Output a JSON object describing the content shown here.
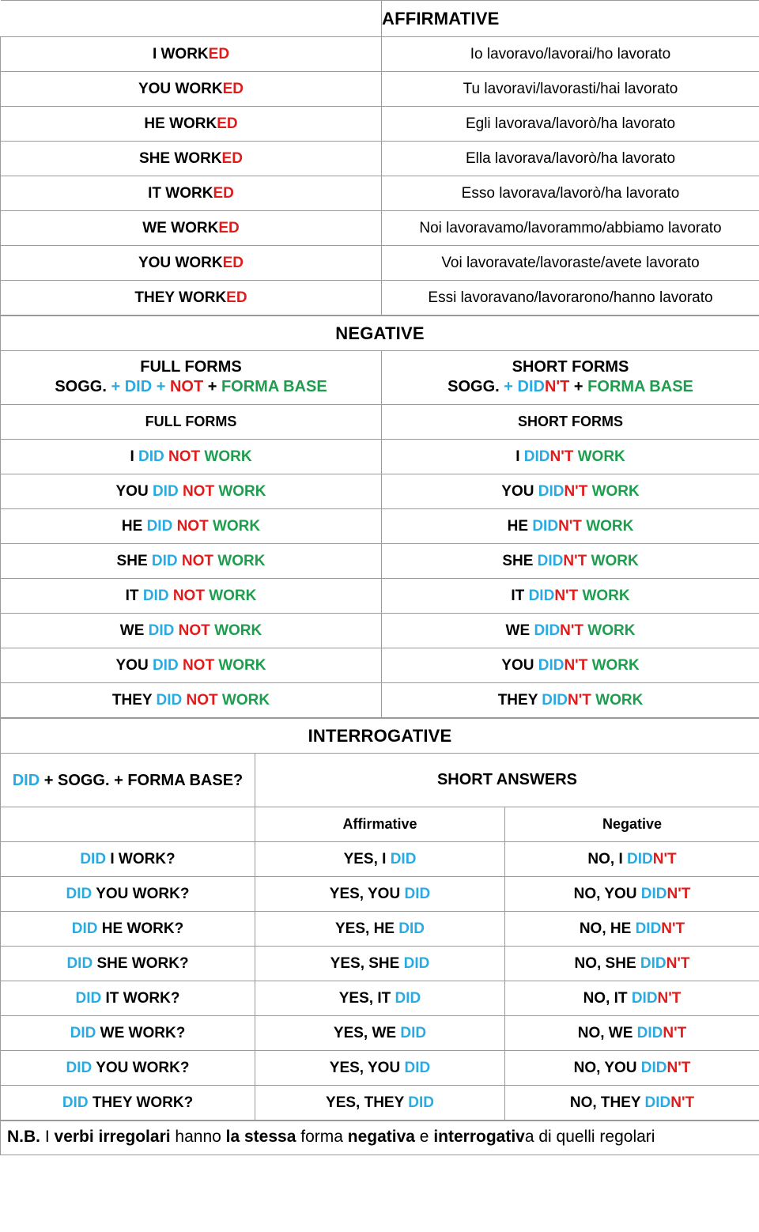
{
  "sections": {
    "affirmative": {
      "title": "AFFIRMATIVE",
      "rows": [
        {
          "subject": "I ",
          "verb": "WORK",
          "suffix": "ED",
          "italian": "Io lavoravo/lavorai/ho lavorato"
        },
        {
          "subject": "YOU ",
          "verb": "WORK",
          "suffix": "ED",
          "italian": "Tu lavoravi/lavorasti/hai lavorato"
        },
        {
          "subject": "HE ",
          "verb": "WORK",
          "suffix": "ED",
          "italian": "Egli lavorava/lavorò/ha lavorato"
        },
        {
          "subject": "SHE ",
          "verb": "WORK",
          "suffix": "ED",
          "italian": "Ella lavorava/lavorò/ha lavorato"
        },
        {
          "subject": "IT ",
          "verb": "WORK",
          "suffix": "ED",
          "italian": "Esso lavorava/lavorò/ha lavorato"
        },
        {
          "subject": "WE ",
          "verb": "WORK",
          "suffix": "ED",
          "italian": "Noi lavoravamo/lavorammo/abbiamo lavorato"
        },
        {
          "subject": "YOU ",
          "verb": "WORK",
          "suffix": "ED",
          "italian": "Voi lavoravate/lavoraste/avete lavorato"
        },
        {
          "subject": "THEY ",
          "verb": "WORK",
          "suffix": "ED",
          "italian": "Essi lavoravano/lavorarono/hanno lavorato"
        }
      ]
    },
    "negative": {
      "title": "NEGATIVE",
      "full_forms_label": "FULL FORMS",
      "short_forms_label": "SHORT FORMS",
      "full_forms_label2": "FULL FORMS",
      "short_forms_label2": "SHORT FORMS",
      "formula_full": {
        "sogg": "SOGG.",
        "plus_did": " + DID",
        "plus2": " + ",
        "not": "NOT",
        "plus3": " + ",
        "base": "FORMA BASE"
      },
      "formula_short": {
        "sogg": "SOGG.",
        "plus": " + ",
        "did": "DID",
        "nt": "N'T",
        "plus3": " + ",
        "base": "FORMA BASE"
      },
      "rows": [
        {
          "subject": "I ",
          "did": "DID ",
          "not": "NOT ",
          "verb": "WORK",
          "s_subject": "I ",
          "s_did": "DID",
          "s_nt": "N'T ",
          "s_verb": "WORK"
        },
        {
          "subject": "YOU ",
          "did": "DID ",
          "not": "NOT ",
          "verb": "WORK",
          "s_subject": "YOU ",
          "s_did": "DID",
          "s_nt": "N'T ",
          "s_verb": "WORK"
        },
        {
          "subject": "HE ",
          "did": "DID ",
          "not": "NOT ",
          "verb": "WORK",
          "s_subject": "HE ",
          "s_did": "DID",
          "s_nt": "N'T ",
          "s_verb": "WORK"
        },
        {
          "subject": "SHE ",
          "did": "DID ",
          "not": "NOT ",
          "verb": "WORK",
          "s_subject": "SHE ",
          "s_did": "DID",
          "s_nt": "N'T ",
          "s_verb": "WORK"
        },
        {
          "subject": "IT ",
          "did": "DID ",
          "not": "NOT ",
          "verb": "WORK",
          "s_subject": "IT ",
          "s_did": "DID",
          "s_nt": "N'T ",
          "s_verb": "WORK"
        },
        {
          "subject": "WE ",
          "did": "DID ",
          "not": "NOT ",
          "verb": "WORK",
          "s_subject": "WE ",
          "s_did": "DID",
          "s_nt": "N'T ",
          "s_verb": "WORK"
        },
        {
          "subject": "YOU ",
          "did": "DID ",
          "not": "NOT ",
          "verb": "WORK",
          "s_subject": "YOU ",
          "s_did": "DID",
          "s_nt": "N'T ",
          "s_verb": "WORK"
        },
        {
          "subject": "THEY ",
          "did": "DID ",
          "not": "NOT ",
          "verb": "WORK",
          "s_subject": "THEY ",
          "s_did": "DID",
          "s_nt": "N'T ",
          "s_verb": "WORK"
        }
      ]
    },
    "interrogative": {
      "title": "INTERROGATIVE",
      "formula": {
        "did": "DID",
        "rest": " + SOGG. + FORMA BASE?"
      },
      "short_answers_label": "SHORT ANSWERS",
      "affirmative_col": "Affirmative",
      "negative_col": "Negative",
      "rows": [
        {
          "q_did": "DID ",
          "q_rest": "I WORK?",
          "a_yes": "YES, I ",
          "a_did": "DID",
          "n_no": "NO, I ",
          "n_did": "DID",
          "n_nt": "N'T"
        },
        {
          "q_did": "DID ",
          "q_rest": "YOU WORK?",
          "a_yes": "YES, YOU ",
          "a_did": "DID",
          "n_no": "NO, YOU ",
          "n_did": "DID",
          "n_nt": "N'T"
        },
        {
          "q_did": "DID ",
          "q_rest": "HE WORK?",
          "a_yes": "YES, HE ",
          "a_did": "DID",
          "n_no": "NO, HE ",
          "n_did": "DID",
          "n_nt": "N'T"
        },
        {
          "q_did": "DID ",
          "q_rest": "SHE WORK?",
          "a_yes": "YES, SHE ",
          "a_did": "DID",
          "n_no": "NO, SHE ",
          "n_did": "DID",
          "n_nt": "N'T"
        },
        {
          "q_did": "DID ",
          "q_rest": "IT WORK?",
          "a_yes": "YES, IT ",
          "a_did": "DID",
          "n_no": "NO, IT ",
          "n_did": "DID",
          "n_nt": "N'T"
        },
        {
          "q_did": "DID ",
          "q_rest": "WE WORK?",
          "a_yes": "YES, WE ",
          "a_did": "DID",
          "n_no": "NO, WE ",
          "n_did": "DID",
          "n_nt": "N'T"
        },
        {
          "q_did": "DID ",
          "q_rest": "YOU WORK?",
          "a_yes": "YES, YOU ",
          "a_did": "DID",
          "n_no": "NO, YOU ",
          "n_did": "DID",
          "n_nt": "N'T"
        },
        {
          "q_did": "DID ",
          "q_rest": "THEY WORK?",
          "a_yes": "YES, THEY ",
          "a_did": "DID",
          "n_no": "NO, THEY ",
          "n_did": "DID",
          "n_nt": "N'T"
        }
      ]
    },
    "note": {
      "p1": "N.B.",
      "p2": " I ",
      "p3": "verbi irregolari",
      "p4": " hanno ",
      "p5": "la stessa",
      "p6": " forma ",
      "p7": "negativa",
      "p8": " e ",
      "p9": "interrogativ",
      "p10": "a di quelli regolari"
    }
  },
  "colors": {
    "red": "#E01B1B",
    "blue": "#29ABE2",
    "green": "#1F9D4E",
    "black": "#000000",
    "border": "#9a9a9a"
  }
}
